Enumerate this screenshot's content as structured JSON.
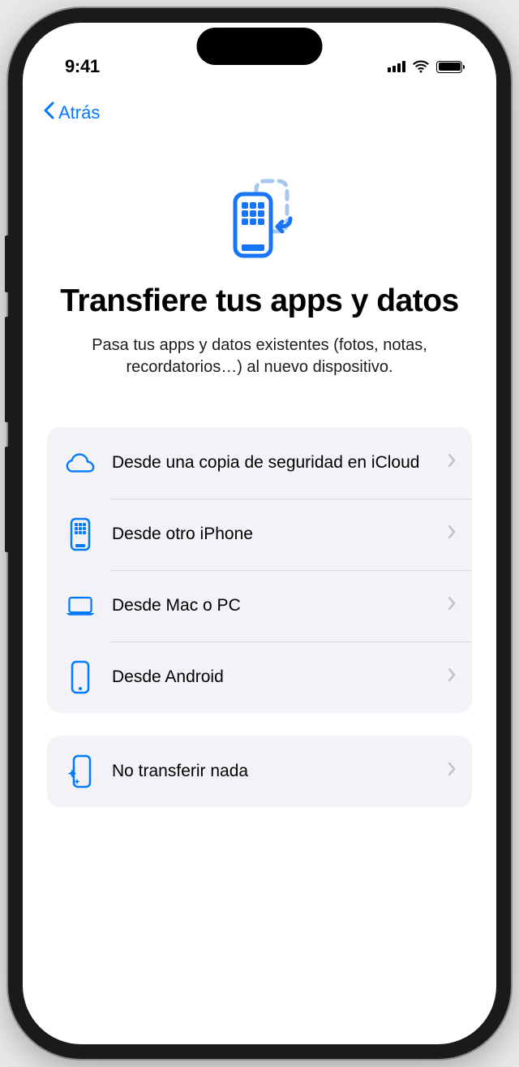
{
  "statusBar": {
    "time": "9:41"
  },
  "nav": {
    "backLabel": "Atrás"
  },
  "hero": {
    "title": "Transfiere tus apps y datos",
    "subtitle": "Pasa tus apps y datos existentes (fotos, notas, recordatorios…) al nuevo dispositivo."
  },
  "options": [
    {
      "id": "icloud",
      "label": "Desde una copia de seguridad en iCloud",
      "icon": "cloud-icon"
    },
    {
      "id": "iphone",
      "label": "Desde otro iPhone",
      "icon": "iphone-icon"
    },
    {
      "id": "mac-pc",
      "label": "Desde Mac o PC",
      "icon": "laptop-icon"
    },
    {
      "id": "android",
      "label": "Desde Android",
      "icon": "android-phone-icon"
    }
  ],
  "secondaryOptions": [
    {
      "id": "nothing",
      "label": "No transferir nada",
      "icon": "sparkle-phone-icon"
    }
  ],
  "colors": {
    "accent": "#007AFF",
    "lightAccent": "#A8C7F0",
    "background": "#ffffff",
    "groupBackground": "#f2f2f7"
  }
}
